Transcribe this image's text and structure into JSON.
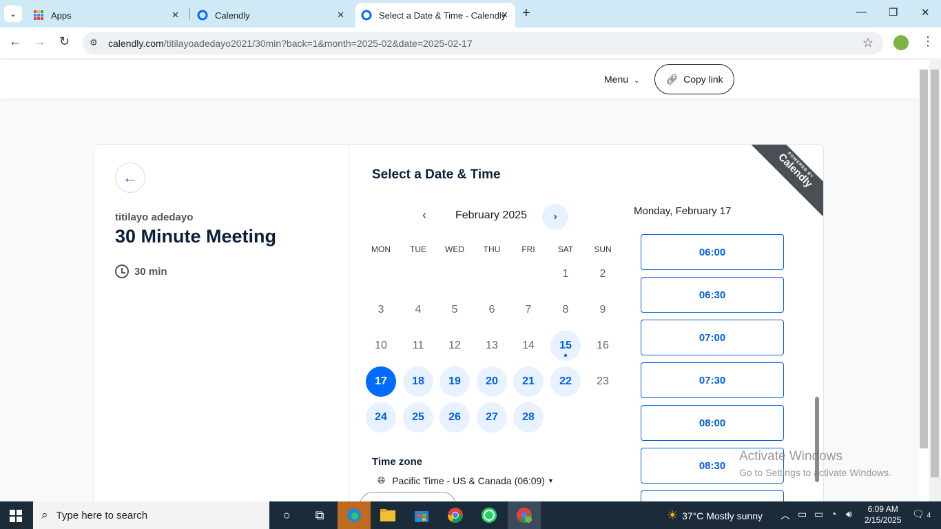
{
  "browser": {
    "tabs": [
      {
        "label": "Apps"
      },
      {
        "label": "Calendly"
      },
      {
        "label": "Select a Date & Time - Calendly"
      }
    ],
    "url_host": "calendly.com",
    "url_path": "/titilayoadedayo2021/30min?back=1&month=2025-02&date=2025-02-17"
  },
  "header": {
    "menu_label": "Menu",
    "copy_link_label": "Copy link"
  },
  "event": {
    "host": "titilayo adedayo",
    "title": "30 Minute Meeting",
    "duration": "30 min"
  },
  "ribbon": {
    "top": "POWERED BY",
    "brand": "Calendly"
  },
  "scheduler": {
    "heading": "Select a Date & Time",
    "month_label": "February 2025",
    "weekdays": [
      "MON",
      "TUE",
      "WED",
      "THU",
      "FRI",
      "SAT",
      "SUN"
    ],
    "selected_date_heading": "Monday, February 17",
    "time_slots": [
      "06:00",
      "06:30",
      "07:00",
      "07:30",
      "08:00",
      "08:30"
    ],
    "timezone_title": "Time zone",
    "timezone_value": "Pacific Time - US & Canada (06:09)"
  },
  "calendar": {
    "year": 2025,
    "month": 2,
    "days": [
      {
        "n": "1",
        "state": "disabled"
      },
      {
        "n": "2",
        "state": "disabled"
      },
      {
        "n": "3",
        "state": "disabled"
      },
      {
        "n": "4",
        "state": "disabled"
      },
      {
        "n": "5",
        "state": "disabled"
      },
      {
        "n": "6",
        "state": "disabled"
      },
      {
        "n": "7",
        "state": "disabled"
      },
      {
        "n": "8",
        "state": "disabled"
      },
      {
        "n": "9",
        "state": "disabled"
      },
      {
        "n": "10",
        "state": "disabled"
      },
      {
        "n": "11",
        "state": "disabled"
      },
      {
        "n": "12",
        "state": "disabled"
      },
      {
        "n": "13",
        "state": "disabled"
      },
      {
        "n": "14",
        "state": "disabled"
      },
      {
        "n": "15",
        "state": "today"
      },
      {
        "n": "16",
        "state": "disabled"
      },
      {
        "n": "17",
        "state": "selected"
      },
      {
        "n": "18",
        "state": "available"
      },
      {
        "n": "19",
        "state": "available"
      },
      {
        "n": "20",
        "state": "available"
      },
      {
        "n": "21",
        "state": "available"
      },
      {
        "n": "22",
        "state": "available"
      },
      {
        "n": "23",
        "state": "disabled"
      },
      {
        "n": "24",
        "state": "available"
      },
      {
        "n": "25",
        "state": "available"
      },
      {
        "n": "26",
        "state": "available"
      },
      {
        "n": "27",
        "state": "available"
      },
      {
        "n": "28",
        "state": "available"
      }
    ]
  },
  "watermark": {
    "line1": "Activate Windows",
    "line2": "Go to Settings to activate Windows."
  },
  "taskbar": {
    "search_placeholder": "Type here to search",
    "weather": "37°C  Mostly sunny",
    "time": "6:09 AM",
    "date": "2/15/2025",
    "notifications": "4"
  },
  "colors": {
    "accent": "#006bff",
    "available_bg": "#e8f1ff",
    "text_dark": "#0b1f3a",
    "taskbar": "#1c2b3a"
  }
}
